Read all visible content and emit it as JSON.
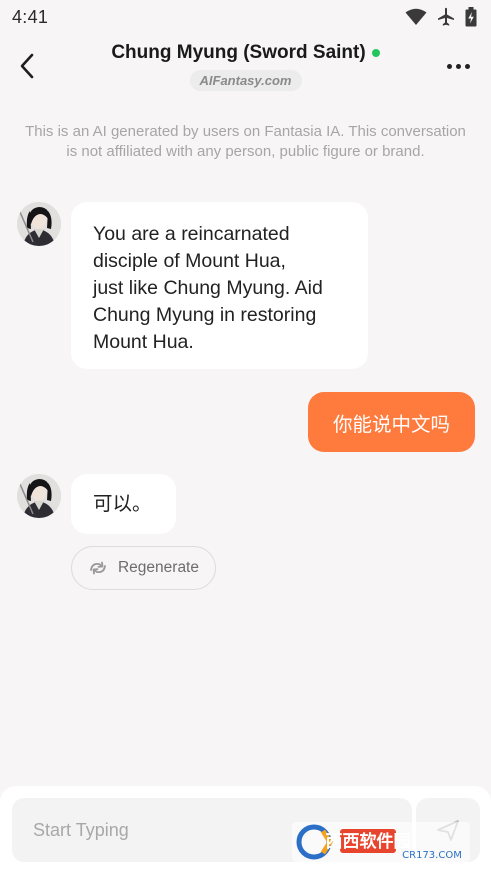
{
  "status": {
    "time": "4:41"
  },
  "header": {
    "title": "Chung Myung (Sword Saint)",
    "site": "AIFantasy.com"
  },
  "disclaimer": "This is an AI generated by users on Fantasia IA. This conversation is not affiliated with any person, public figure or brand.",
  "messages": [
    {
      "sender": "ai",
      "lines": [
        "You are a reincarnated",
        "disciple of Mount Hua,",
        "just like Chung Myung. Aid",
        "Chung Myung in restoring",
        "Mount Hua."
      ]
    },
    {
      "sender": "user",
      "text": "你能说中文吗"
    },
    {
      "sender": "ai",
      "text": "可以。"
    }
  ],
  "actions": {
    "regenerate": "Regenerate"
  },
  "composer": {
    "placeholder": "Start Typing"
  },
  "watermark": {
    "brand": "西西软件园",
    "url": "CR173.COM"
  },
  "colors": {
    "accent": "#ff7a3d",
    "online": "#22c55e",
    "background": "#f7f5f6"
  }
}
